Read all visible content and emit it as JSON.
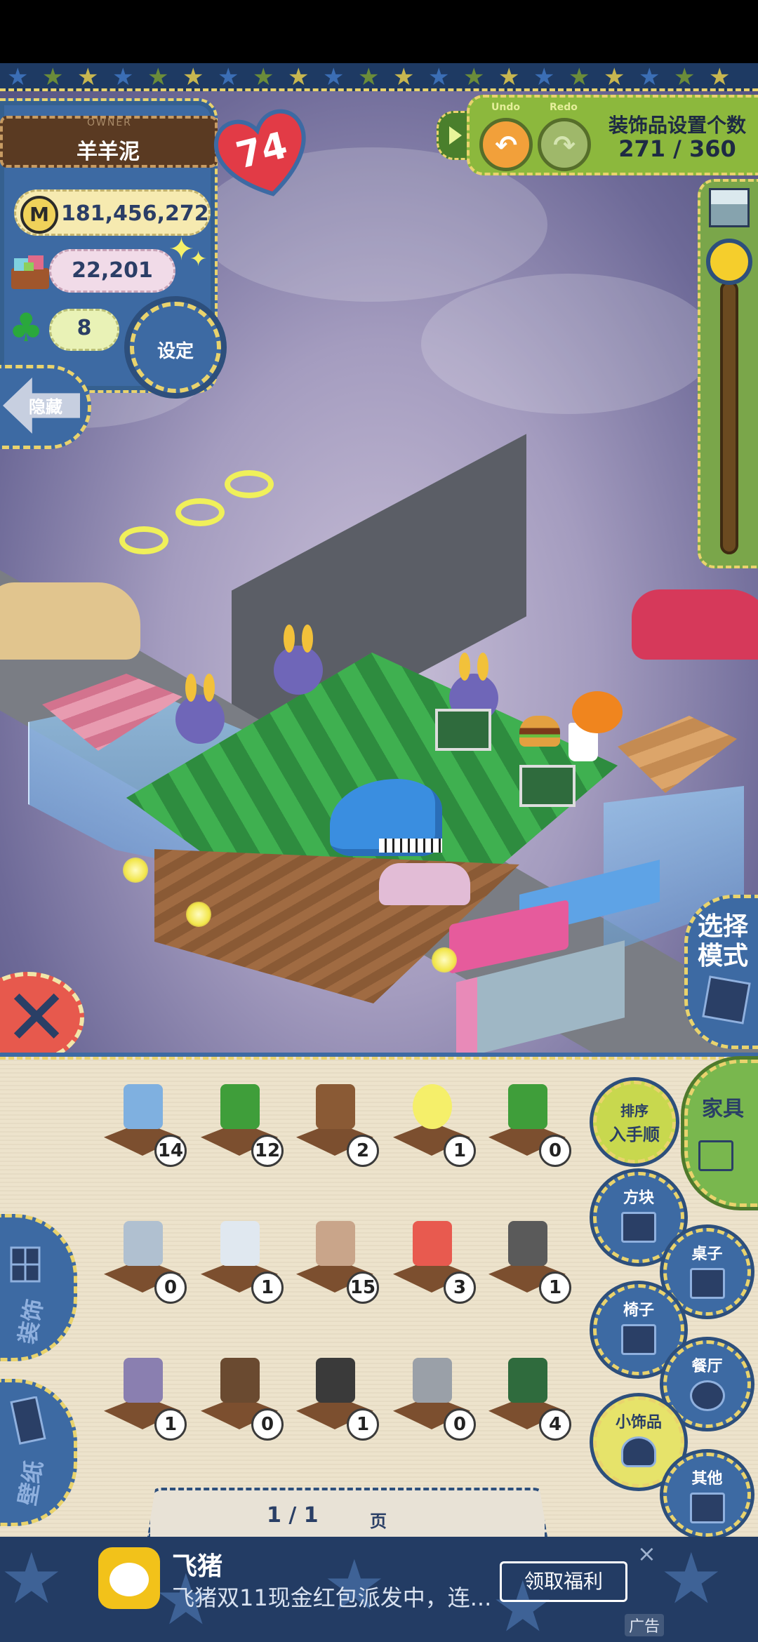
{
  "hud": {
    "owner_caption": "OWNER",
    "owner_name": "羊羊泥",
    "coins": "181,456,272",
    "coin_symbol": "M",
    "gifts": "22,201",
    "clovers": "8",
    "hearts": "74",
    "settings_label": "设定",
    "hide_label": "隐藏"
  },
  "decor": {
    "undo_label": "Undo",
    "redo_label": "Redo",
    "title": "装饰品设置个数",
    "count": "271 / 360"
  },
  "mode_button": {
    "label": "选择模式"
  },
  "inventory": {
    "items": [
      {
        "name": "potted-flower",
        "count": "14"
      },
      {
        "name": "leafy-plant",
        "count": "12"
      },
      {
        "name": "music-box",
        "count": "2"
      },
      {
        "name": "glowing-lamp",
        "count": "1"
      },
      {
        "name": "tall-plant",
        "count": "0"
      },
      {
        "name": "flower-tray",
        "count": "0"
      },
      {
        "name": "display-fridge",
        "count": "1"
      },
      {
        "name": "table-lamp",
        "count": "15"
      },
      {
        "name": "alarm-clock",
        "count": "3"
      },
      {
        "name": "ashtray",
        "count": "1"
      },
      {
        "name": "building-model",
        "count": "1"
      },
      {
        "name": "record-player",
        "count": "0"
      },
      {
        "name": "trash-bin",
        "count": "1"
      },
      {
        "name": "round-plate",
        "count": "0"
      },
      {
        "name": "menu-sign",
        "count": "4"
      }
    ],
    "page": "1 / 1",
    "page_unit": "页"
  },
  "side_tabs": {
    "decor": "装饰",
    "wallpaper": "壁纸"
  },
  "categories": {
    "sort_line1": "排序",
    "sort_line2": "入手顺",
    "furniture": "家具",
    "block": "方块",
    "table": "桌子",
    "chair": "椅子",
    "restaurant": "餐厅",
    "small_decor": "小饰品",
    "other": "其他"
  },
  "ad": {
    "title": "飞猪",
    "description": "飞猪双11现金红包派发中，连...",
    "button": "领取福利",
    "close": "×",
    "mark": "广告"
  },
  "colors": {
    "denim": "#3d6aa3",
    "stitch": "#e9d36d",
    "green_panel": "#8cb83d",
    "heart": "#e23b46"
  }
}
